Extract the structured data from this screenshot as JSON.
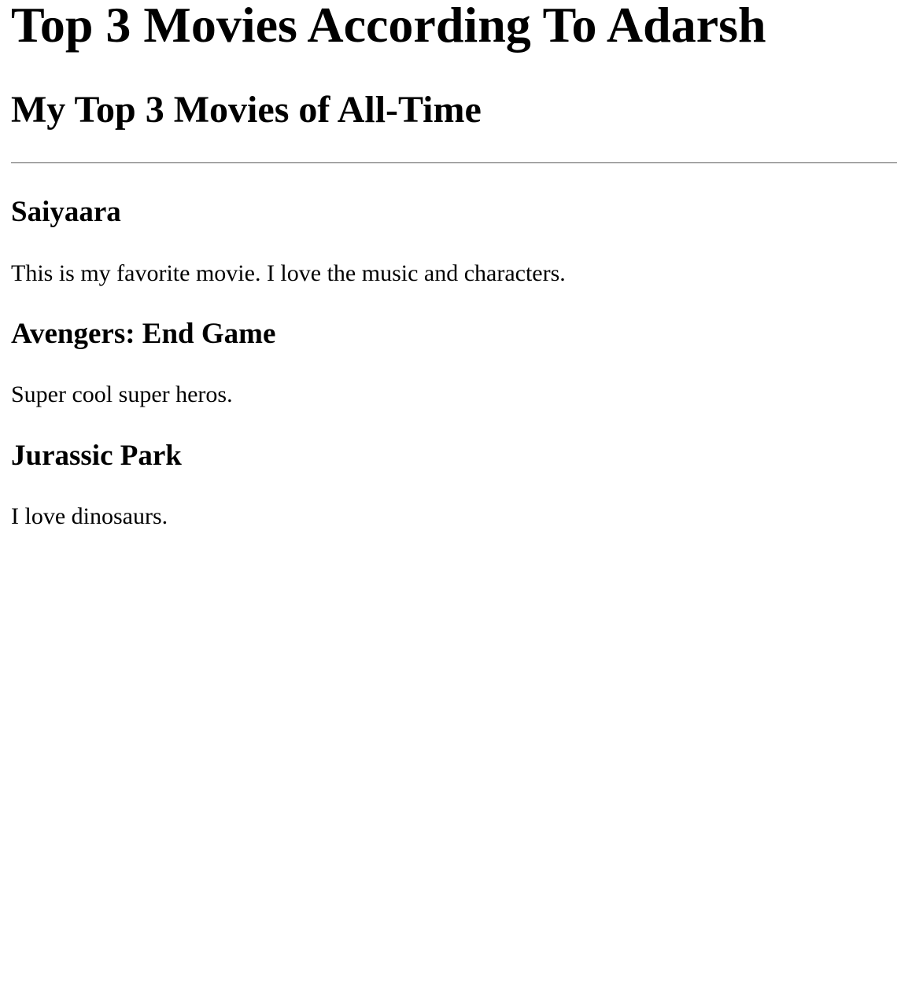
{
  "page": {
    "title": "Top 3 Movies According To Adarsh",
    "subtitle": "My Top 3 Movies of All-Time"
  },
  "movies": [
    {
      "title": "Saiyaara",
      "description": "This is my favorite movie. I love the music and characters."
    },
    {
      "title": "Avengers: End Game",
      "description": "Super cool super heros."
    },
    {
      "title": "Jurassic Park",
      "description": "I love dinosaurs."
    }
  ]
}
